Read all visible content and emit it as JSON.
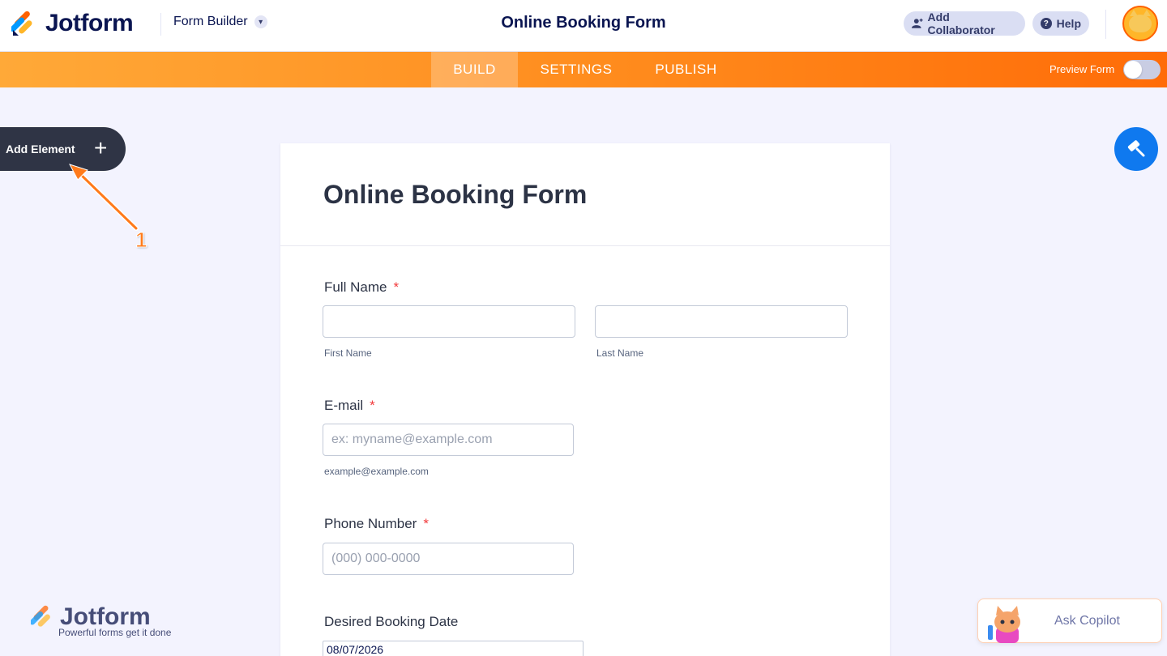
{
  "header": {
    "brand": "Jotform",
    "builder_label": "Form Builder",
    "form_title": "Online Booking Form",
    "add_collaborator": "Add Collaborator",
    "help": "Help"
  },
  "nav": {
    "tabs": [
      {
        "label": "BUILD",
        "active": true
      },
      {
        "label": "SETTINGS",
        "active": false
      },
      {
        "label": "PUBLISH",
        "active": false
      }
    ],
    "preview_label": "Preview Form",
    "preview_enabled": false
  },
  "sidebar": {
    "add_element_label": "Add Element",
    "add_element_icon": "plus-icon"
  },
  "annotation": {
    "number": "1"
  },
  "form": {
    "title": "Online Booking Form",
    "fields": {
      "full_name": {
        "label": "Full Name",
        "required_mark": "*",
        "first_sublabel": "First Name",
        "last_sublabel": "Last Name"
      },
      "email": {
        "label": "E-mail",
        "required_mark": "*",
        "placeholder": "ex: myname@example.com",
        "sublabel": "example@example.com"
      },
      "phone": {
        "label": "Phone Number",
        "required_mark": "*",
        "placeholder": "(000) 000-0000"
      },
      "booking_date": {
        "label": "Desired Booking Date",
        "value": "08/07/2026"
      }
    }
  },
  "footer": {
    "brand": "Jotform",
    "tagline": "Powerful forms get it done"
  },
  "copilot": {
    "label": "Ask Copilot"
  },
  "colors": {
    "brand_navy": "#0a1551",
    "accent_orange": "#ff6100",
    "design_blue": "#0f79ef",
    "required_red": "#f23a3c"
  }
}
